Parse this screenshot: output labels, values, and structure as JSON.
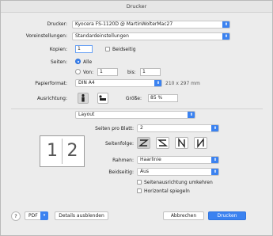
{
  "window": {
    "title": "Drucker"
  },
  "printer": {
    "label": "Drucker:",
    "value": "Kyocera FS-1120D @ MartinWolterMac27"
  },
  "presets": {
    "label": "Voreinstellungen:",
    "value": "Standardeinstellungen"
  },
  "copies": {
    "label": "Kopien:",
    "value": "1",
    "duplex_label": "Beidseitig"
  },
  "pages": {
    "label": "Seiten:",
    "all_label": "Alle",
    "from_label": "Von:",
    "from_value": "1",
    "to_label": "bis:",
    "to_value": "1"
  },
  "paper": {
    "label": "Papierformat:",
    "value": "DIN A4",
    "size_text": "210 x 297 mm"
  },
  "orientation": {
    "label": "Ausrichtung:"
  },
  "scale": {
    "label": "Größe:",
    "value": "85 %"
  },
  "section": {
    "value": "Layout"
  },
  "preview": {
    "left": "1",
    "right": "2"
  },
  "layout": {
    "pages_per_sheet_label": "Seiten pro Blatt:",
    "pages_per_sheet_value": "2",
    "direction_label": "Seitenfolge:",
    "border_label": "Rahmen:",
    "border_value": "Haarlinie",
    "duplex_label": "Beidseitig:",
    "duplex_value": "Aus",
    "reverse_orientation_label": "Seitenausrichtung umkehren",
    "flip_horizontal_label": "Horizontal spiegeln"
  },
  "footer": {
    "help": "?",
    "pdf_label": "PDF",
    "details_label": "Details ausblenden",
    "cancel_label": "Abbrechen",
    "print_label": "Drucken"
  },
  "colors": {
    "accent": "#3b82f0",
    "window_bg": "#ececec"
  }
}
